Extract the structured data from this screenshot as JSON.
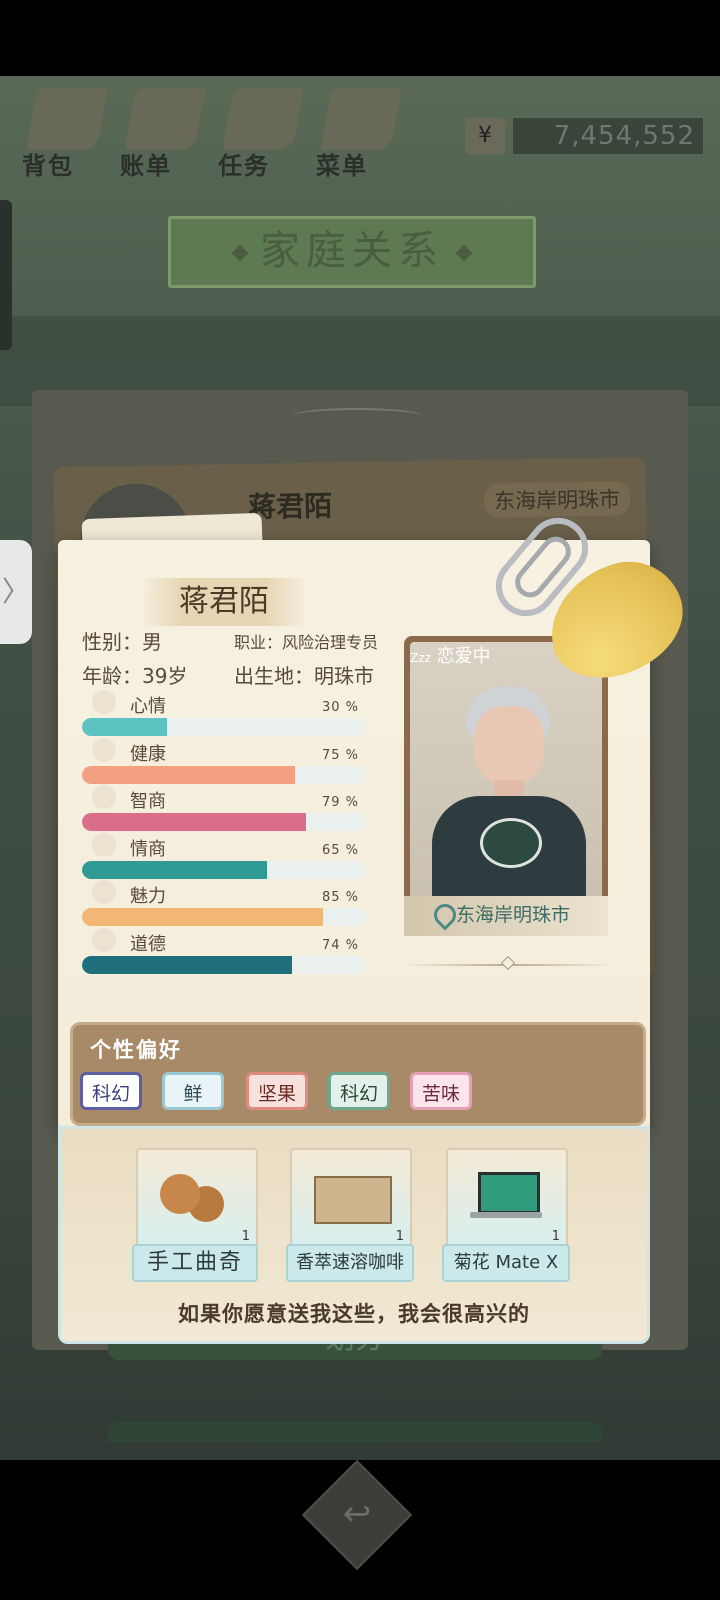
{
  "top_nav": {
    "items": [
      {
        "label": "背包",
        "icon": "backpack-icon"
      },
      {
        "label": "账单",
        "icon": "bill-icon"
      },
      {
        "label": "任务",
        "icon": "task-icon"
      },
      {
        "label": "菜单",
        "icon": "menu-icon"
      }
    ],
    "currency_symbol": "¥",
    "money": "7,454,552"
  },
  "page_title": "家庭关系",
  "side_handle_glyph": "〉",
  "background_card": {
    "name": "蒋君陌",
    "location": "东海岸明珠市"
  },
  "profile": {
    "name": "蒋君陌",
    "gender": "性别：男",
    "job": "职业：风险治理专员",
    "age": "年龄：39岁",
    "birthplace": "出生地：明珠市",
    "status": "恋爱中",
    "status_prefix": "Zzz",
    "location": "东海岸明珠市"
  },
  "stats": [
    {
      "label": "心情",
      "percent": 30,
      "text": "30 %",
      "icon": "smile-icon",
      "color": "#5cc3c0"
    },
    {
      "label": "健康",
      "percent": 75,
      "text": "75 %",
      "icon": "heart-icon",
      "color": "#f3a080"
    },
    {
      "label": "智商",
      "percent": 79,
      "text": "79 %",
      "icon": "lightbulb-icon",
      "color": "#d96d8a"
    },
    {
      "label": "情商",
      "percent": 65,
      "text": "65 %",
      "icon": "apple-icon",
      "color": "#2f9a93"
    },
    {
      "label": "魅力",
      "percent": 85,
      "text": "85 %",
      "icon": "sparkle-icon",
      "color": "#f2b675"
    },
    {
      "label": "道德",
      "percent": 74,
      "text": "74 %",
      "icon": "scales-icon",
      "color": "#1e6e7c"
    }
  ],
  "preferences": {
    "title": "个性偏好",
    "tags": [
      "科幻",
      "鲜",
      "坚果",
      "科幻",
      "苦味"
    ]
  },
  "gifts": {
    "items": [
      {
        "name": "手工曲奇",
        "count": "1",
        "icon": "cookie-icon"
      },
      {
        "name": "香萃速溶咖啡",
        "count": "1",
        "icon": "coffee-box-icon"
      },
      {
        "name": "菊花 Mate X",
        "count": "1",
        "icon": "laptop-icon"
      }
    ],
    "message": "如果你愿意送我这些，我会很高兴的"
  },
  "background_buttons": {
    "first_label": "划分"
  },
  "back_button_glyph": "↩"
}
